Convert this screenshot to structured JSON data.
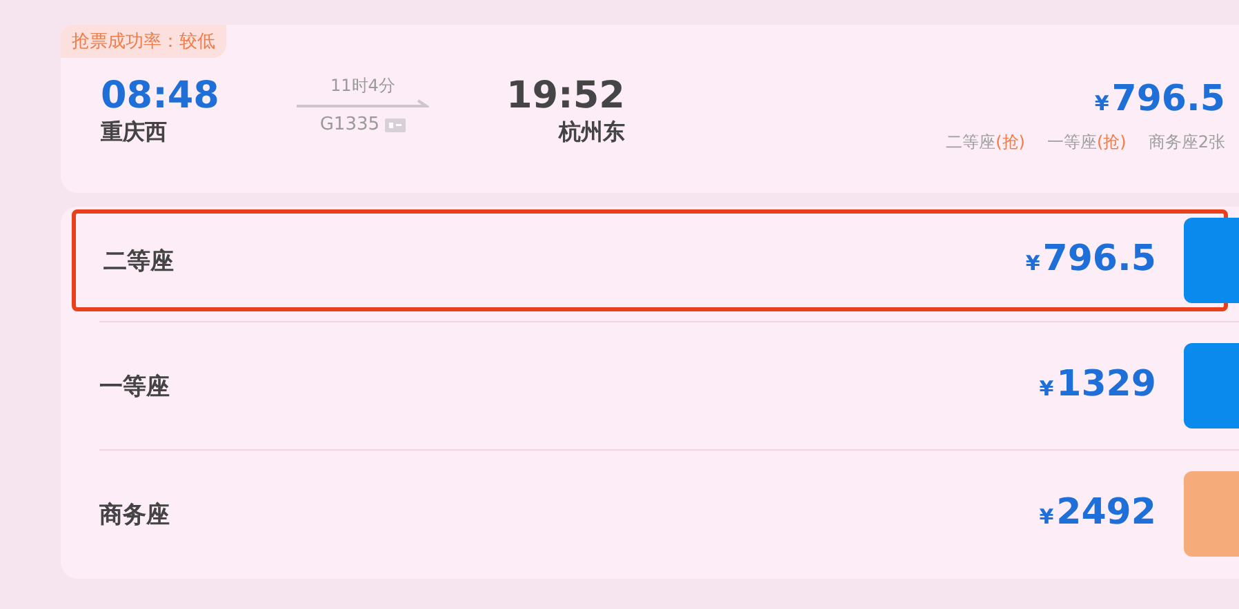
{
  "train": {
    "success_rate": "抢票成功率：较低",
    "depart_time": "08:48",
    "depart_station": "重庆西",
    "duration": "11时4分",
    "train_no": "G1335",
    "arrive_time": "19:52",
    "arrive_station": "杭州东",
    "price_symbol": "¥",
    "price": "796.5",
    "seat_summary": [
      {
        "name": "二等座",
        "tag": "(抢)"
      },
      {
        "name": "一等座",
        "tag": "(抢)"
      },
      {
        "name": "商务座2张"
      }
    ]
  },
  "seats": [
    {
      "name": "二等座",
      "price_symbol": "¥",
      "price": "796.5",
      "highlighted": true,
      "kind": "book"
    },
    {
      "name": "一等座",
      "price_symbol": "¥",
      "price": "1329",
      "highlighted": false,
      "kind": "book"
    },
    {
      "name": "商务座",
      "price_symbol": "¥",
      "price": "2492",
      "highlighted": false,
      "kind": "grab"
    }
  ]
}
